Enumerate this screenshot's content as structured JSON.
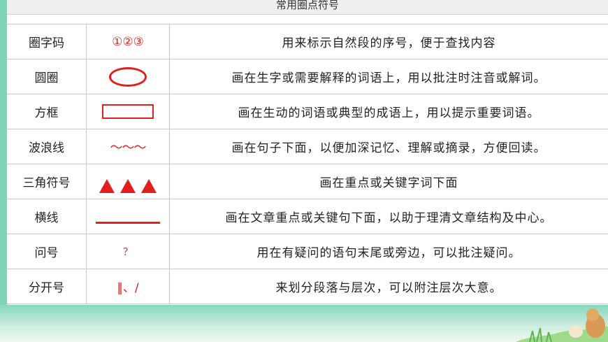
{
  "title": "常用圈点符号",
  "rows": [
    {
      "name": "圈字码",
      "symbol_text": "①②③",
      "symbol_icon": "circled-numbers-icon",
      "desc": "用来标示自然段的序号，便于查找内容"
    },
    {
      "name": "圆圈",
      "symbol_icon": "oval-icon",
      "desc": "画在生字或需要解释的词语上，用以批注时注音或解词。"
    },
    {
      "name": "方框",
      "symbol_icon": "rectangle-icon",
      "desc": "画在生动的词语或典型的成语上，用以提示重要词语。"
    },
    {
      "name": "波浪线",
      "symbol_text": "～～～",
      "symbol_icon": "wavy-line-icon",
      "desc": "画在句子下面，以便加深记忆、理解或摘录，方便回读。"
    },
    {
      "name": "三角符号",
      "symbol_icon": "triangles-icon",
      "desc": "画在重点或关键字词下面"
    },
    {
      "name": "横线",
      "symbol_icon": "horizontal-line-icon",
      "desc": "画在文章重点或关键句下面，以助于理清文章结构及中心。"
    },
    {
      "name": "问号",
      "symbol_text": "？",
      "symbol_icon": "question-mark-icon",
      "desc": "用在有疑问的语句末尾或旁边，可以批注疑问。"
    },
    {
      "name": "分开号",
      "symbol_text": "‖、/",
      "symbol_icon": "separator-marks-icon",
      "desc": "来划分段落与层次，可以附注层次大意。"
    }
  ],
  "colors": {
    "accent": "#e21f1f",
    "background": "#7ed4b8"
  }
}
